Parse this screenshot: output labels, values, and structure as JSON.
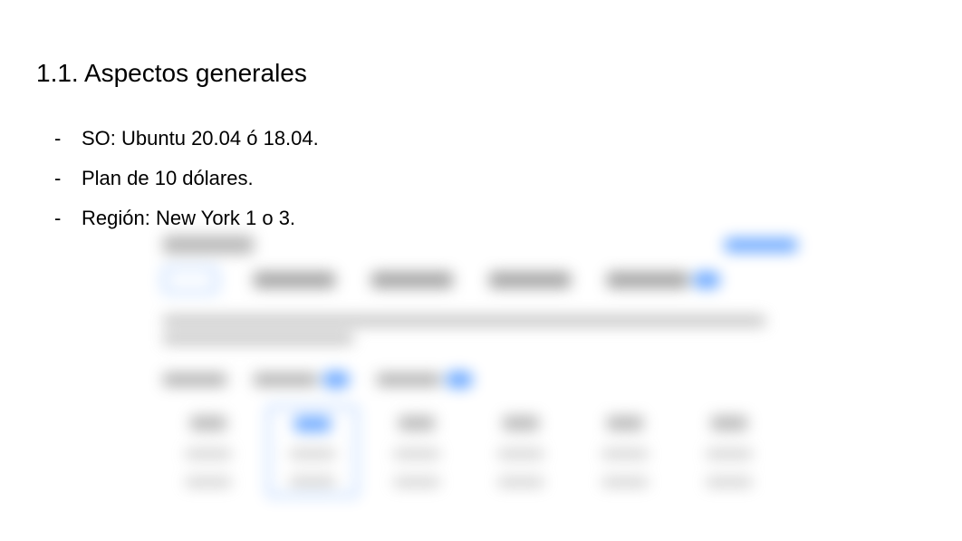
{
  "heading": "1.1. Aspectos generales",
  "bullets": [
    "SO: Ubuntu 20.04 ó 18.04.",
    "Plan de 10 dólares.",
    "Región: New York 1 o 3."
  ]
}
